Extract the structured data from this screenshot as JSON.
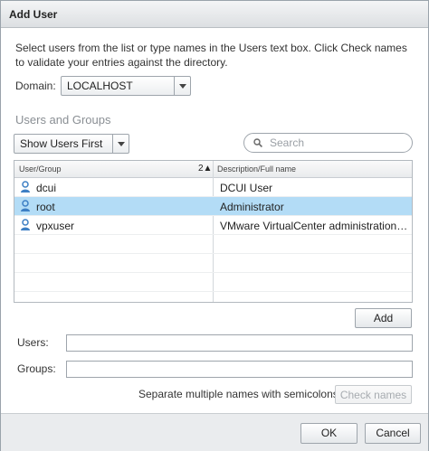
{
  "dialog": {
    "title": "Add User",
    "instructions": "Select users from the list or type names in the Users text box. Click Check names to validate your entries against the directory."
  },
  "domain": {
    "label": "Domain:",
    "selected": "LOCALHOST"
  },
  "users_groups": {
    "heading": "Users and Groups",
    "filter_selected": "Show Users First",
    "search_placeholder": "Search",
    "columns": {
      "user_group": "User/Group",
      "sort_indicator": "2▲",
      "description": "Description/Full name"
    },
    "rows": [
      {
        "name": "dcui",
        "description": "DCUI User",
        "selected": false
      },
      {
        "name": "root",
        "description": "Administrator",
        "selected": true
      },
      {
        "name": "vpxuser",
        "description": "VMware VirtualCenter administration account",
        "selected": false
      }
    ]
  },
  "buttons": {
    "add": "Add",
    "check_names": "Check names",
    "ok": "OK",
    "cancel": "Cancel"
  },
  "fields": {
    "users_label": "Users:",
    "users_value": "",
    "groups_label": "Groups:",
    "groups_value": ""
  },
  "hint": "Separate multiple names with semicolons",
  "colors": {
    "selected_row": "#b3dcf6",
    "user_icon": "#3d7fc4"
  },
  "icons": {
    "user": "user-icon",
    "search": "search-icon",
    "dropdown": "chevron-down-icon"
  }
}
